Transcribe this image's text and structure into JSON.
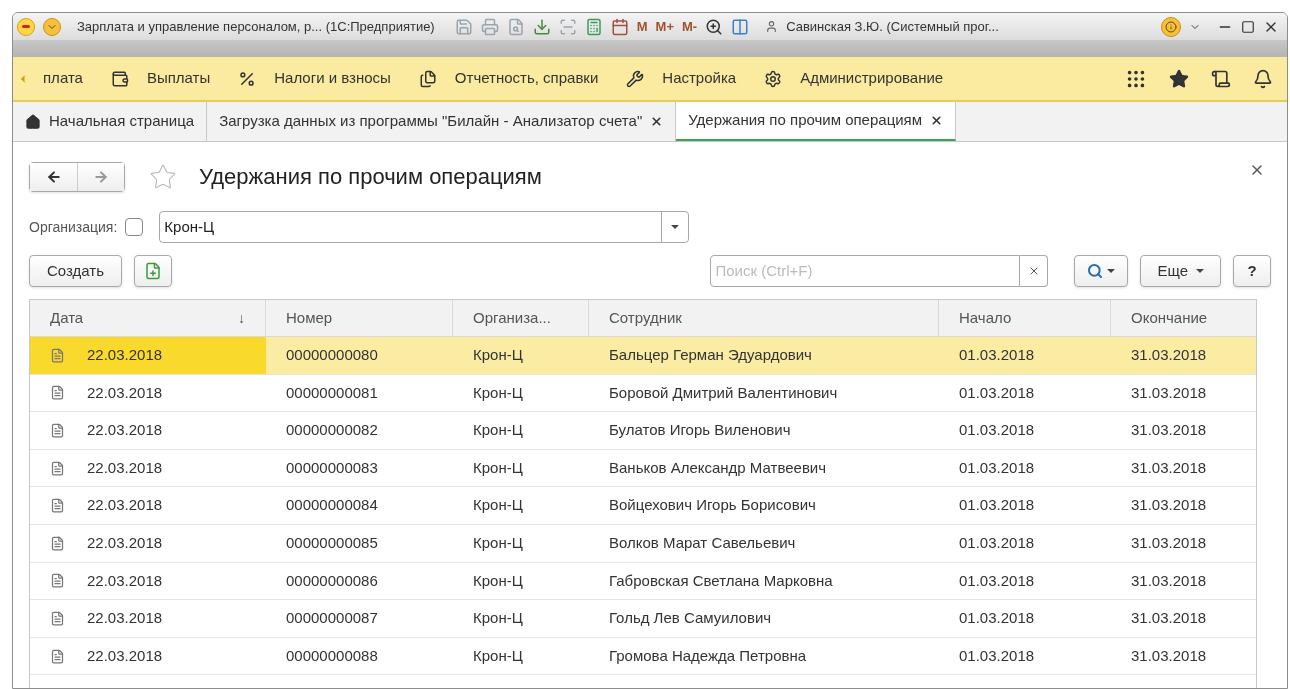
{
  "window": {
    "title": "Зарплата и управление персоналом, р...  (1С:Предприятие)",
    "user": "Савинская З.Ю. (Системный прог...",
    "toolbar": [
      "M",
      "M+",
      "M-"
    ]
  },
  "sections": [
    {
      "label": "плата",
      "kind": "partial"
    },
    {
      "label": "Выплаты",
      "kind": "wallet"
    },
    {
      "label": "Налоги и взносы",
      "kind": "percent"
    },
    {
      "label": "Отчетность, справки",
      "kind": "reports"
    },
    {
      "label": "Настройка",
      "kind": "wrench"
    },
    {
      "label": "Администрирование",
      "kind": "gear"
    }
  ],
  "tabs": [
    {
      "label": "Начальная страница",
      "selected": false,
      "closable": false
    },
    {
      "label": "Загрузка данных из программы \"Билайн - Анализатор счета\"",
      "selected": false,
      "closable": true
    },
    {
      "label": "Удержания по прочим операциям",
      "selected": true,
      "closable": true
    }
  ],
  "form": {
    "title": "Удержания по прочим операциям",
    "favorite": false,
    "filter": {
      "label": "Организация:",
      "checked": false,
      "value": "Крон-Ц"
    },
    "create_button": "Создать",
    "search": {
      "placeholder": "Поиск (Ctrl+F)"
    },
    "more_button": "Еще",
    "help_button": "?"
  },
  "table": {
    "columns": [
      {
        "label": "Дата",
        "sort_mark": "↓"
      },
      {
        "label": "Номер"
      },
      {
        "label": "Организа..."
      },
      {
        "label": "Сотрудник"
      },
      {
        "label": "Начало"
      },
      {
        "label": "Окончание"
      }
    ],
    "rows": [
      {
        "selected": true,
        "cells": [
          "22.03.2018",
          "00000000080",
          "Крон-Ц",
          "Бальцер Герман Эдуардович",
          "01.03.2018",
          "31.03.2018"
        ]
      },
      {
        "selected": false,
        "cells": [
          "22.03.2018",
          "00000000081",
          "Крон-Ц",
          "Боровой Дмитрий Валентинович",
          "01.03.2018",
          "31.03.2018"
        ]
      },
      {
        "selected": false,
        "cells": [
          "22.03.2018",
          "00000000082",
          "Крон-Ц",
          "Булатов Игорь Виленович",
          "01.03.2018",
          "31.03.2018"
        ]
      },
      {
        "selected": false,
        "cells": [
          "22.03.2018",
          "00000000083",
          "Крон-Ц",
          "Ваньков Александр Матвеевич",
          "01.03.2018",
          "31.03.2018"
        ]
      },
      {
        "selected": false,
        "cells": [
          "22.03.2018",
          "00000000084",
          "Крон-Ц",
          "Войцехович Игорь Борисович",
          "01.03.2018",
          "31.03.2018"
        ]
      },
      {
        "selected": false,
        "cells": [
          "22.03.2018",
          "00000000085",
          "Крон-Ц",
          "Волков Марат Савельевич",
          "01.03.2018",
          "31.03.2018"
        ]
      },
      {
        "selected": false,
        "cells": [
          "22.03.2018",
          "00000000086",
          "Крон-Ц",
          "Габровская Светлана Марковна",
          "01.03.2018",
          "31.03.2018"
        ]
      },
      {
        "selected": false,
        "cells": [
          "22.03.2018",
          "00000000087",
          "Крон-Ц",
          "Гольд Лев Самуилович",
          "01.03.2018",
          "31.03.2018"
        ]
      },
      {
        "selected": false,
        "cells": [
          "22.03.2018",
          "00000000088",
          "Крон-Ц",
          "Громова Надежда Петровна",
          "01.03.2018",
          "31.03.2018"
        ]
      }
    ]
  }
}
